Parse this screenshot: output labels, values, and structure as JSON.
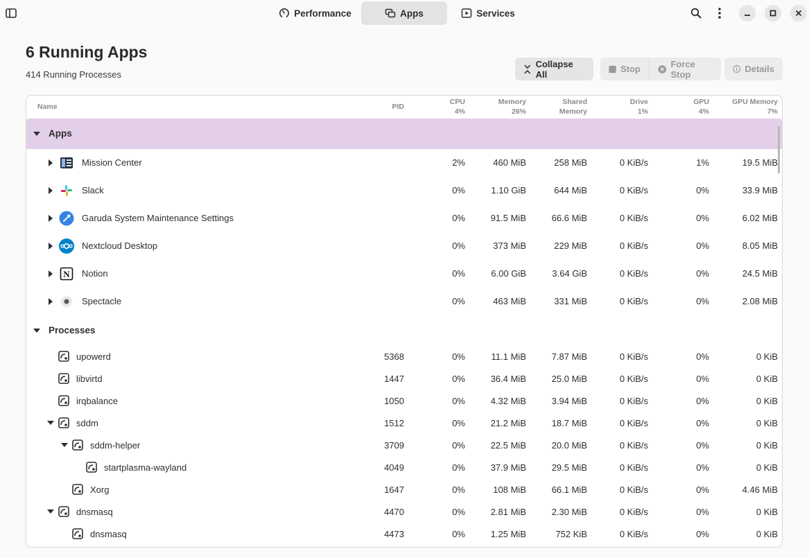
{
  "header": {
    "tabs": [
      {
        "label": "Performance",
        "icon": "gauge-icon",
        "active": false
      },
      {
        "label": "Apps",
        "icon": "apps-icon",
        "active": true
      },
      {
        "label": "Services",
        "icon": "services-icon",
        "active": false
      }
    ]
  },
  "page": {
    "title": "6 Running Apps",
    "subtitle": "414 Running Processes"
  },
  "actions": {
    "collapse_all": "Collapse All",
    "stop": "Stop",
    "force_stop": "Force Stop",
    "details": "Details"
  },
  "columns": {
    "name": "Name",
    "pid": "PID",
    "cpu": "CPU",
    "cpu_total": "4%",
    "memory": "Memory",
    "memory_total": "26%",
    "shared_1": "Shared",
    "shared_2": "Memory",
    "drive": "Drive",
    "drive_total": "1%",
    "gpu": "GPU",
    "gpu_total": "4%",
    "gpu_memory": "GPU Memory",
    "gpu_memory_total": "7%"
  },
  "groups": {
    "apps": "Apps",
    "processes": "Processes"
  },
  "apps": [
    {
      "name": "Mission Center",
      "icon": "mission-center-icon",
      "cpu": "2%",
      "memory": "460 MiB",
      "shared": "258 MiB",
      "drive": "0 KiB/s",
      "gpu": "1%",
      "gpu_memory": "19.5 MiB"
    },
    {
      "name": "Slack",
      "icon": "slack-icon",
      "cpu": "0%",
      "memory": "1.10 GiB",
      "shared": "644 MiB",
      "drive": "0 KiB/s",
      "gpu": "0%",
      "gpu_memory": "33.9 MiB"
    },
    {
      "name": "Garuda System Maintenance Settings",
      "icon": "garuda-icon",
      "cpu": "0%",
      "memory": "91.5 MiB",
      "shared": "66.6 MiB",
      "drive": "0 KiB/s",
      "gpu": "0%",
      "gpu_memory": "6.02 MiB"
    },
    {
      "name": "Nextcloud Desktop",
      "icon": "nextcloud-icon",
      "cpu": "0%",
      "memory": "373 MiB",
      "shared": "229 MiB",
      "drive": "0 KiB/s",
      "gpu": "0%",
      "gpu_memory": "8.05 MiB"
    },
    {
      "name": "Notion",
      "icon": "notion-icon",
      "cpu": "0%",
      "memory": "6.00 GiB",
      "shared": "3.64 GiB",
      "drive": "0 KiB/s",
      "gpu": "0%",
      "gpu_memory": "24.5 MiB"
    },
    {
      "name": "Spectacle",
      "icon": "spectacle-icon",
      "cpu": "0%",
      "memory": "463 MiB",
      "shared": "331 MiB",
      "drive": "0 KiB/s",
      "gpu": "0%",
      "gpu_memory": "2.08 MiB"
    }
  ],
  "processes": [
    {
      "name": "upowerd",
      "pid": "5368",
      "cpu": "0%",
      "memory": "11.1 MiB",
      "shared": "7.87 MiB",
      "drive": "0 KiB/s",
      "gpu": "0%",
      "gpu_memory": "0 KiB"
    },
    {
      "name": "libvirtd",
      "pid": "1447",
      "cpu": "0%",
      "memory": "36.4 MiB",
      "shared": "25.0 MiB",
      "drive": "0 KiB/s",
      "gpu": "0%",
      "gpu_memory": "0 KiB"
    },
    {
      "name": "irqbalance",
      "pid": "1050",
      "cpu": "0%",
      "memory": "4.32 MiB",
      "shared": "3.94 MiB",
      "drive": "0 KiB/s",
      "gpu": "0%",
      "gpu_memory": "0 KiB"
    },
    {
      "name": "sddm",
      "pid": "1512",
      "cpu": "0%",
      "memory": "21.2 MiB",
      "shared": "18.7 MiB",
      "drive": "0 KiB/s",
      "gpu": "0%",
      "gpu_memory": "0 KiB"
    },
    {
      "name": "sddm-helper",
      "pid": "3709",
      "cpu": "0%",
      "memory": "22.5 MiB",
      "shared": "20.0 MiB",
      "drive": "0 KiB/s",
      "gpu": "0%",
      "gpu_memory": "0 KiB"
    },
    {
      "name": "startplasma-wayland",
      "pid": "4049",
      "cpu": "0%",
      "memory": "37.9 MiB",
      "shared": "29.5 MiB",
      "drive": "0 KiB/s",
      "gpu": "0%",
      "gpu_memory": "0 KiB"
    },
    {
      "name": "Xorg",
      "pid": "1647",
      "cpu": "0%",
      "memory": "108 MiB",
      "shared": "66.1 MiB",
      "drive": "0 KiB/s",
      "gpu": "0%",
      "gpu_memory": "4.46 MiB"
    },
    {
      "name": "dnsmasq",
      "pid": "4470",
      "cpu": "0%",
      "memory": "2.81 MiB",
      "shared": "2.30 MiB",
      "drive": "0 KiB/s",
      "gpu": "0%",
      "gpu_memory": "0 KiB"
    },
    {
      "name": "dnsmasq",
      "pid": "4473",
      "cpu": "0%",
      "memory": "1.25 MiB",
      "shared": "752 KiB",
      "drive": "0 KiB/s",
      "gpu": "0%",
      "gpu_memory": "0 KiB"
    }
  ],
  "colors": {
    "accent_group": "#e3cfe8",
    "tab_active": "#e3e3e5"
  }
}
